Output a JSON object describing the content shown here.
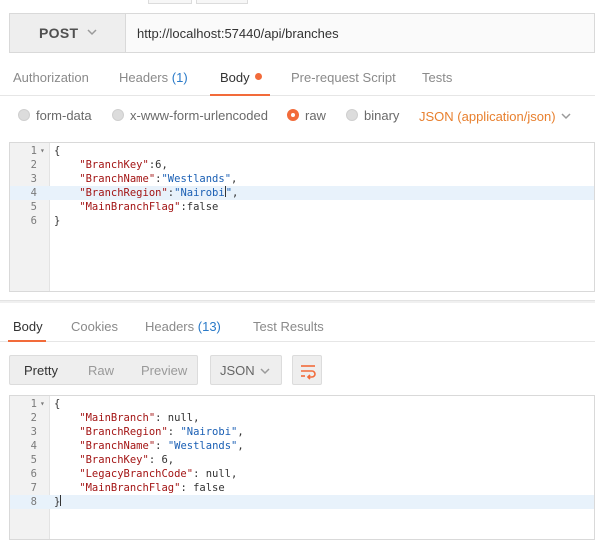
{
  "request": {
    "method": "POST",
    "url": "http://localhost:57440/api/branches"
  },
  "request_tabs": [
    {
      "label": "Authorization",
      "count": ""
    },
    {
      "label": "Headers",
      "count": "(1)"
    },
    {
      "label": "Body",
      "count": ""
    },
    {
      "label": "Pre-request Script",
      "count": ""
    },
    {
      "label": "Tests",
      "count": ""
    }
  ],
  "body_types": {
    "form_data": "form-data",
    "urlencoded": "x-www-form-urlencoded",
    "raw": "raw",
    "binary": "binary",
    "content_type": "JSON (application/json)"
  },
  "request_body": {
    "lines": [
      {
        "n": "1",
        "tokens": [
          [
            "p",
            "{"
          ]
        ]
      },
      {
        "n": "2",
        "tokens": [
          [
            "k",
            "    \"BranchKey\""
          ],
          [
            "p",
            ":6,"
          ]
        ]
      },
      {
        "n": "3",
        "tokens": [
          [
            "k",
            "    \"BranchName\""
          ],
          [
            "p",
            ":"
          ],
          [
            "s",
            "\"Westlands\""
          ],
          [
            "p",
            ","
          ]
        ]
      },
      {
        "n": "4",
        "tokens": [
          [
            "k",
            "    \"BranchRegion\""
          ],
          [
            "p",
            ":"
          ],
          [
            "s",
            "\"Nairobi"
          ],
          [
            "cursor",
            ""
          ],
          [
            "s",
            "\""
          ],
          [
            "p",
            ","
          ]
        ]
      },
      {
        "n": "5",
        "tokens": [
          [
            "k",
            "    \"MainBranchFlag\""
          ],
          [
            "p",
            ":false"
          ]
        ]
      },
      {
        "n": "6",
        "tokens": [
          [
            "p",
            "}"
          ]
        ]
      }
    ]
  },
  "response_tabs": [
    {
      "label": "Body",
      "count": ""
    },
    {
      "label": "Cookies",
      "count": ""
    },
    {
      "label": "Headers",
      "count": "(13)"
    },
    {
      "label": "Test Results",
      "count": ""
    }
  ],
  "response_view": {
    "pretty": "Pretty",
    "raw": "Raw",
    "preview": "Preview",
    "format": "JSON"
  },
  "response_body": {
    "lines": [
      {
        "n": "1",
        "tokens": [
          [
            "p",
            "{"
          ]
        ]
      },
      {
        "n": "2",
        "tokens": [
          [
            "k",
            "    \"MainBranch\""
          ],
          [
            "p",
            ": null,"
          ]
        ]
      },
      {
        "n": "3",
        "tokens": [
          [
            "k",
            "    \"BranchRegion\""
          ],
          [
            "p",
            ": "
          ],
          [
            "s",
            "\"Nairobi\""
          ],
          [
            "p",
            ","
          ]
        ]
      },
      {
        "n": "4",
        "tokens": [
          [
            "k",
            "    \"BranchName\""
          ],
          [
            "p",
            ": "
          ],
          [
            "s",
            "\"Westlands\""
          ],
          [
            "p",
            ","
          ]
        ]
      },
      {
        "n": "5",
        "tokens": [
          [
            "k",
            "    \"BranchKey\""
          ],
          [
            "p",
            ": 6,"
          ]
        ]
      },
      {
        "n": "6",
        "tokens": [
          [
            "k",
            "    \"LegacyBranchCode\""
          ],
          [
            "p",
            ": null,"
          ]
        ]
      },
      {
        "n": "7",
        "tokens": [
          [
            "k",
            "    \"MainBranchFlag\""
          ],
          [
            "p",
            ": false"
          ]
        ]
      },
      {
        "n": "8",
        "tokens": [
          [
            "p",
            "}"
          ],
          [
            "cursor",
            ""
          ]
        ]
      }
    ]
  },
  "colors": {
    "accent": "#f26b3a",
    "count_blue": "#2a7ac8",
    "json_orange": "#e8802f"
  }
}
